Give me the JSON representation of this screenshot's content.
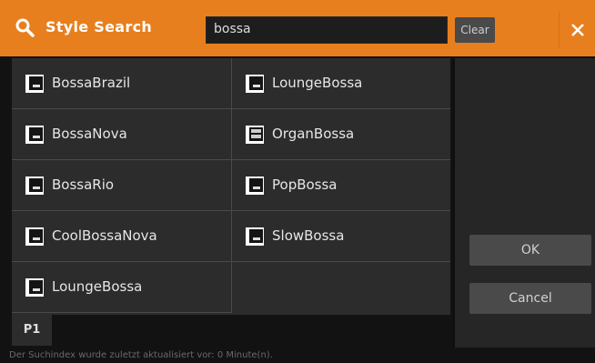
{
  "header": {
    "title": "Style Search",
    "search_value": "bossa",
    "clear_label": "Clear",
    "close_icon": "close-icon",
    "search_icon": "search-icon",
    "accent": "#e77f1e"
  },
  "results": [
    {
      "label": "BossaBrazil",
      "icon": "style-file-icon"
    },
    {
      "label": "BossaNova",
      "icon": "style-file-icon"
    },
    {
      "label": "BossaRio",
      "icon": "style-file-icon"
    },
    {
      "label": "CoolBossaNova",
      "icon": "style-file-icon"
    },
    {
      "label": "LoungeBossa",
      "icon": "style-file-icon"
    },
    {
      "label": "LoungeBossa",
      "icon": "style-file-icon"
    },
    {
      "label": "OrganBossa",
      "icon": "style-organ-icon"
    },
    {
      "label": "PopBossa",
      "icon": "style-file-icon"
    },
    {
      "label": "SlowBossa",
      "icon": "style-file-icon"
    }
  ],
  "page_tab": "P1",
  "buttons": {
    "ok": "OK",
    "cancel": "Cancel"
  },
  "status": "Der Suchindex wurde zuletzt aktualisiert vor: 0 Minute(n)."
}
